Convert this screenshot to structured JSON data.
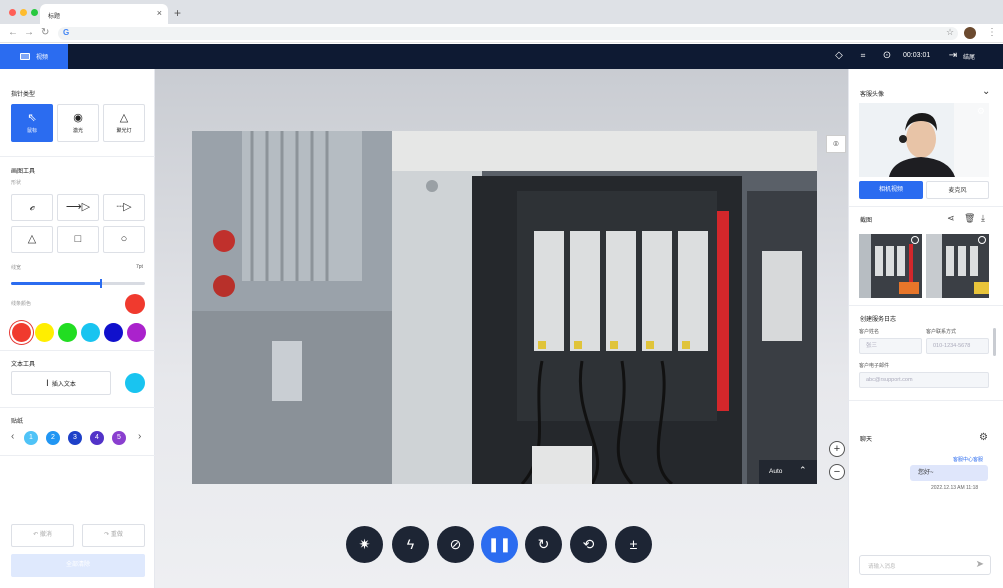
{
  "browser": {
    "tab_title": "标题",
    "tab_close": "×",
    "new_tab": "+",
    "url": ""
  },
  "header": {
    "video_tab_label": "视频",
    "timer": "00:03:01",
    "end_label": "结尾"
  },
  "left_panel": {
    "pointer_section_title": "指针类型",
    "pointer_types": [
      {
        "label": "鼠标",
        "icon": "cursor-icon",
        "selected": true
      },
      {
        "label": "激光",
        "icon": "laser-icon",
        "selected": false
      },
      {
        "label": "聚光灯",
        "icon": "spotlight-icon",
        "selected": false
      }
    ],
    "draw_section_title": "画图工具",
    "shape_sub": "形状",
    "shape_tools": [
      "freehand-pen-icon",
      "solid-arrow-icon",
      "dashed-arrow-icon",
      "triangle-icon",
      "square-icon",
      "circle-icon"
    ],
    "thickness_label": "线宽",
    "thickness_value": "7pt",
    "thickness_fraction": 0.67,
    "line_color_label": "线条颜色",
    "line_color": "#f03a2e",
    "palette": [
      "#f03a2e",
      "#ffee00",
      "#22dd22",
      "#19c4f0",
      "#1010cc",
      "#aa22cc"
    ],
    "text_section_title": "文本工具",
    "insert_text_label": "插入文本",
    "text_color": "#19c4f0",
    "sticker_section_title": "贴纸",
    "pages": [
      "1",
      "2",
      "3",
      "4",
      "5"
    ],
    "page_colors": [
      "#4fc3f7",
      "#2196f3",
      "#1e40c8",
      "#5233c8",
      "#8a3fcf"
    ],
    "prev": "‹",
    "next": "›",
    "undo_label": "撤消",
    "redo_label": "重做",
    "clear_label": "全部清除"
  },
  "center": {
    "auto_label": "Auto",
    "zoom_in": "+",
    "zoom_out": "−"
  },
  "right_panel": {
    "customer_cam_title": "客服头像",
    "camera_btn": "相机视频",
    "mic_btn": "麦克风",
    "screenshot_title": "截图",
    "log_title": "创建服务日志",
    "customer_name_label": "客户姓名",
    "customer_name_placeholder": "张三",
    "customer_contact_label": "客户联系方式",
    "customer_contact_placeholder": "010-1234-5678",
    "customer_email_label": "客户电子邮件",
    "customer_email_placeholder": "abc@rsupport.com",
    "chat_title": "聊天",
    "chat_sender": "客服中心客服",
    "chat_message": "您好~",
    "chat_time": "2022.12.13 AM 11:18",
    "chat_input_placeholder": "请输入消息"
  }
}
